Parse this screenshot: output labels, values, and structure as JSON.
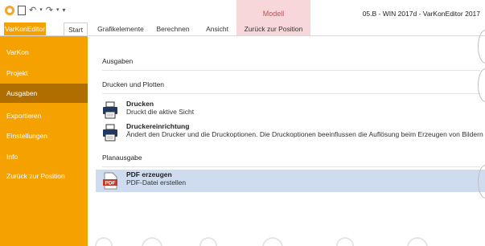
{
  "titlebar": {
    "window_title": "05.B - WIN 2017d - VarKonEditor 2017",
    "context_group_label": "Modell",
    "icons": [
      "app-icon",
      "save-icon",
      "undo-icon",
      "redo-icon",
      "customize-qat-icon"
    ]
  },
  "ribbon": {
    "tabs": [
      {
        "label": "VarKonEditor"
      },
      {
        "label": "Start"
      },
      {
        "label": "Grafikelemente"
      },
      {
        "label": "Berechnen"
      },
      {
        "label": "Ansicht"
      },
      {
        "label": "Zurück zur Position"
      }
    ]
  },
  "nav": {
    "items": [
      {
        "label": "VarKon"
      },
      {
        "label": "Projekt"
      },
      {
        "label": "Ausgaben"
      },
      {
        "label": "Exportieren"
      },
      {
        "label": "Einstellungen"
      },
      {
        "label": "Info"
      },
      {
        "label": "Zurück zur Position"
      }
    ],
    "active": "Ausgaben"
  },
  "main": {
    "title": "Ausgaben",
    "print_section": "Drucken und Plotten",
    "print": {
      "title": "Drucken",
      "description": "Druckt die aktive Sicht"
    },
    "printer_setup": {
      "title": "Druckereinrichtung",
      "description": "Ändert den Drucker und die Druckoptionen. Die Druckoptionen beeinflussen die Auflösung beim Erzeugen von Bildern"
    },
    "plan_section": "Planausgabe",
    "pdf": {
      "title": "PDF erzeugen",
      "description": "PDF-Datei erstellen",
      "icon_text": "PDF"
    }
  },
  "colors": {
    "accent": "#f5a100",
    "nav_active": "#b06e00",
    "context_tab": "#f7d7d9",
    "selected_row": "#cfdcef"
  }
}
